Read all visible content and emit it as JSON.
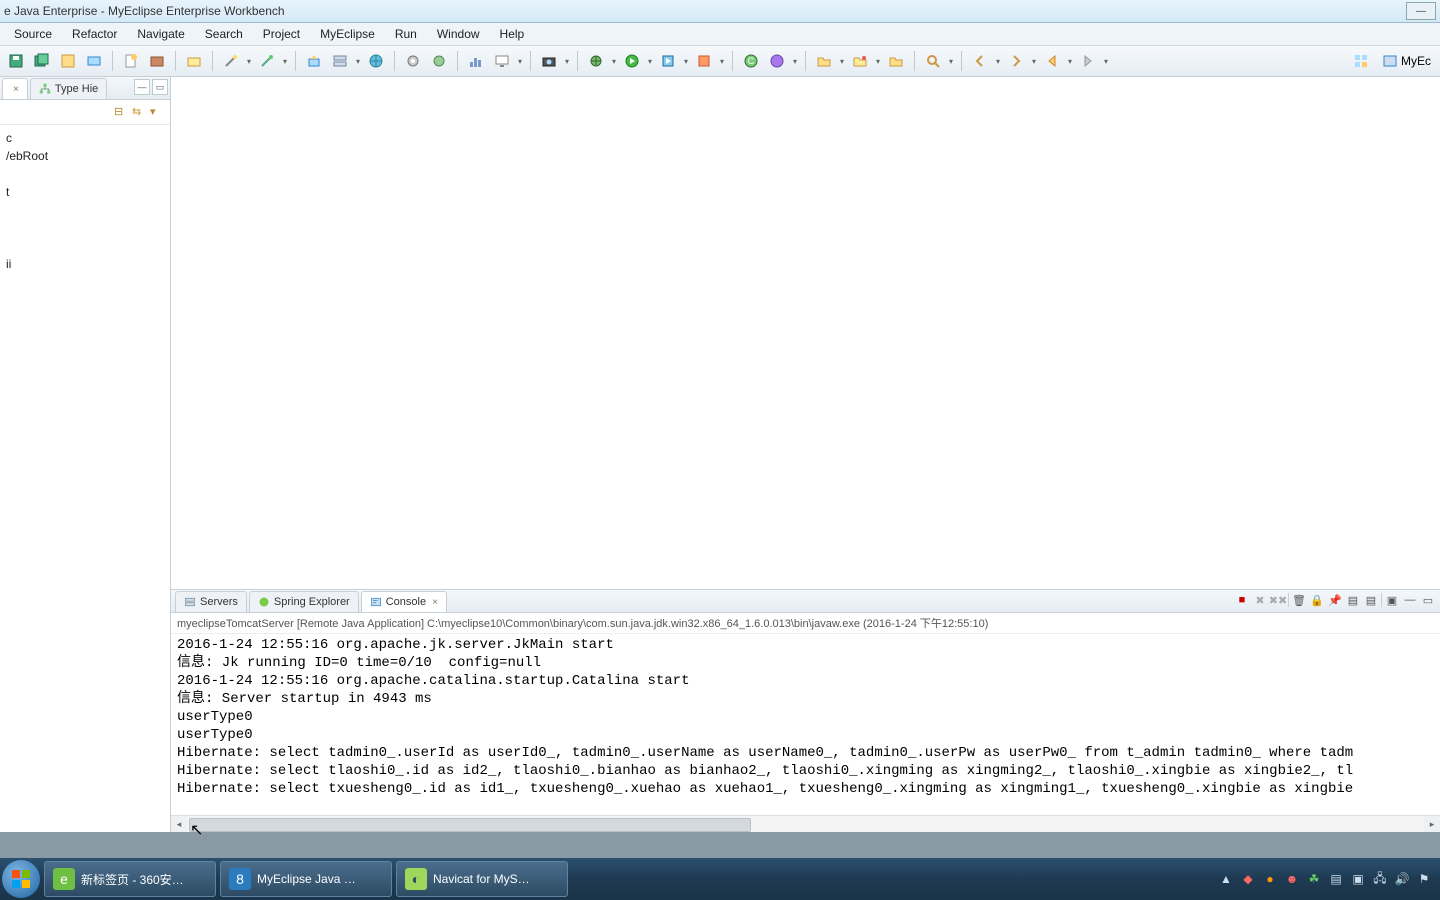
{
  "title": "e Java Enterprise - MyEclipse Enterprise Workbench",
  "menu": [
    "Source",
    "Refactor",
    "Navigate",
    "Search",
    "Project",
    "MyEclipse",
    "Run",
    "Window",
    "Help"
  ],
  "left_tabs": {
    "active_close": "×",
    "tab2": "Type Hie"
  },
  "left_tree": {
    "item1": "c",
    "item2": "/ebRoot",
    "item3": "t",
    "item4": "ii"
  },
  "bottom_tabs": {
    "servers": "Servers",
    "spring": "Spring Explorer",
    "console": "Console",
    "console_close": "×"
  },
  "console_desc": "myeclipseTomcatServer [Remote Java Application] C:\\myeclipse10\\Common\\binary\\com.sun.java.jdk.win32.x86_64_1.6.0.013\\bin\\javaw.exe (2016-1-24 下午12:55:10)",
  "console_lines": [
    "2016-1-24 12:55:16 org.apache.jk.server.JkMain start",
    "信息: Jk running ID=0 time=0/10  config=null",
    "2016-1-24 12:55:16 org.apache.catalina.startup.Catalina start",
    "信息: Server startup in 4943 ms",
    "userType0",
    "userType0",
    "Hibernate: select tadmin0_.userId as userId0_, tadmin0_.userName as userName0_, tadmin0_.userPw as userPw0_ from t_admin tadmin0_ where tadm",
    "Hibernate: select tlaoshi0_.id as id2_, tlaoshi0_.bianhao as bianhao2_, tlaoshi0_.xingming as xingming2_, tlaoshi0_.xingbie as xingbie2_, tl",
    "Hibernate: select txuesheng0_.id as id1_, txuesheng0_.xuehao as xuehao1_, txuesheng0_.xingming as xingming1_, txuesheng0_.xingbie as xingbie"
  ],
  "perspective_label": "MyEc",
  "taskbar": {
    "item1": "新标签页 - 360安…",
    "item2": "MyEclipse Java …",
    "item3": "Navicat for MyS…"
  }
}
